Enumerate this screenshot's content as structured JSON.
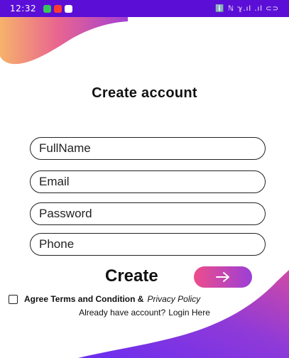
{
  "status_bar": {
    "time": "12:32",
    "notification_icons": [
      "notification-green-icon",
      "notification-red-icon",
      "notification-gallery-icon"
    ],
    "indicators": "ℹ️ ℕ ℽ.ıl .ıl ⊂⊃",
    "background": "#5b0fd6"
  },
  "title": "Create account",
  "fields": {
    "fullname_placeholder": "FullName",
    "email_placeholder": "Email",
    "password_placeholder": "Password",
    "phone_placeholder": "Phone"
  },
  "create": {
    "label": "Create",
    "button_icon": "arrow-right-icon"
  },
  "terms": {
    "agree_text": "Agree Terms and Condition &",
    "policy_link": "Privacy Policy",
    "checked": false
  },
  "login": {
    "prompt": "Already have account?",
    "link": "Login Here"
  },
  "colors": {
    "accent_pink": "#ee4d8b",
    "accent_purple": "#9b3fd6",
    "status_bar": "#5b0fd6"
  }
}
